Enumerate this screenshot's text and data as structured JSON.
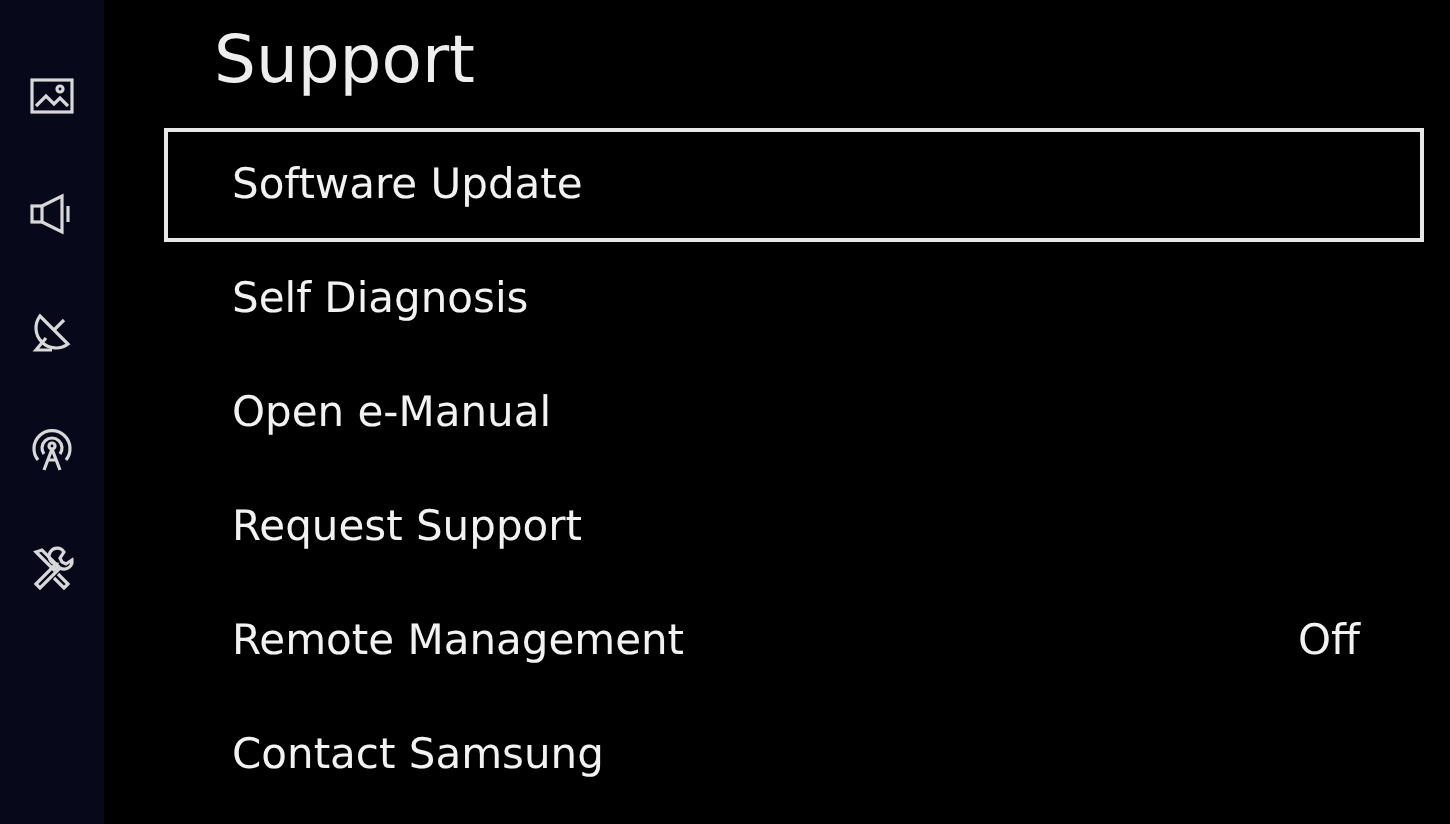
{
  "title": "Support",
  "items": [
    {
      "label": "Software Update",
      "selected": true
    },
    {
      "label": "Self Diagnosis",
      "selected": false
    },
    {
      "label": "Open e-Manual",
      "selected": false
    },
    {
      "label": "Request Support",
      "selected": false
    },
    {
      "label": "Remote Management",
      "selected": false,
      "value": "Off"
    },
    {
      "label": "Contact Samsung",
      "selected": false
    }
  ]
}
